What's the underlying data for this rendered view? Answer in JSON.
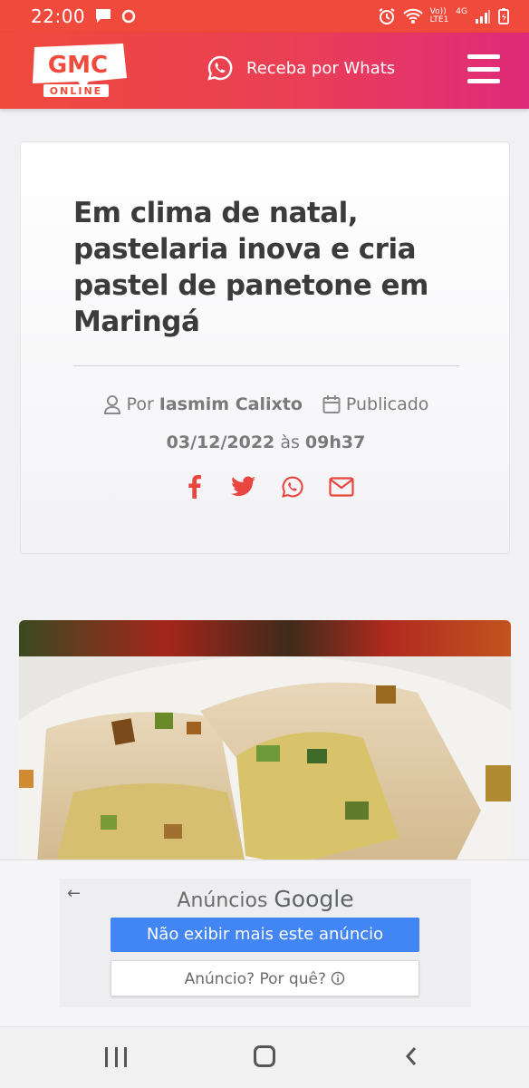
{
  "status": {
    "time": "22:00",
    "network": "4G",
    "volte": "Vo))",
    "lte": "LTE1"
  },
  "header": {
    "logo_main": "GMC",
    "logo_sub": "ONLINE",
    "whats_label": "Receba por Whats"
  },
  "article": {
    "title": "Em clima de natal, pastelaria inova e cria pastel de panetone em Maringá",
    "by_prefix": "Por",
    "author": "Iasmim Calixto",
    "published_label": "Publicado",
    "date": "03/12/2022",
    "at": "às",
    "time": "09h37"
  },
  "ad": {
    "title_prefix": "Anúncios",
    "title_brand": "Google",
    "hide_button": "Não exibir mais este anúncio",
    "why_button": "Anúncio? Por quê?"
  }
}
